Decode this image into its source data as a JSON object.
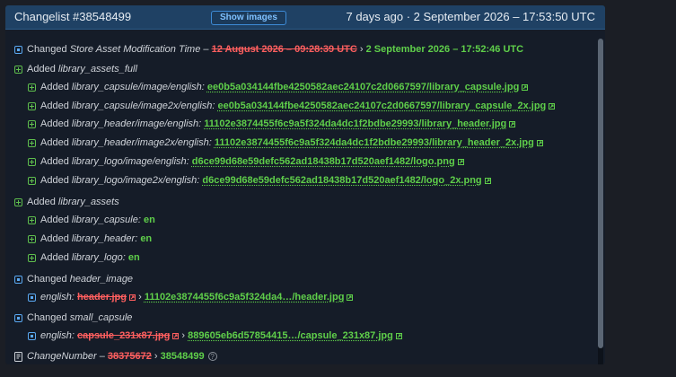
{
  "header": {
    "title": "Changelist #38548499",
    "show_images_label": "Show images",
    "date": "7 days ago · 2 September 2026 – 17:53:50 UTC"
  },
  "rows": {
    "r0": {
      "verb": "Changed",
      "key": "Store Asset Modification Time",
      "dash": "–",
      "old": "12 August 2026 – 09:28:39 UTC",
      "sep": "›",
      "new": "2 September 2026 – 17:52:46 UTC"
    },
    "r1": {
      "verb": "Added",
      "key": "library_assets_full"
    },
    "r2": {
      "verb": "Added",
      "key": "library_capsule/image/english:",
      "value": "ee0b5a034144fbe4250582aec24107c2d0667597/library_capsule.jpg"
    },
    "r3": {
      "verb": "Added",
      "key": "library_capsule/image2x/english:",
      "value": "ee0b5a034144fbe4250582aec24107c2d0667597/library_capsule_2x.jpg"
    },
    "r4": {
      "verb": "Added",
      "key": "library_header/image/english:",
      "value": "11102e3874455f6c9a5f324da4dc1f2bdbe29993/library_header.jpg"
    },
    "r5": {
      "verb": "Added",
      "key": "library_header/image2x/english:",
      "value": "11102e3874455f6c9a5f324da4dc1f2bdbe29993/library_header_2x.jpg"
    },
    "r6": {
      "verb": "Added",
      "key": "library_logo/image/english:",
      "value": "d6ce99d68e59defc562ad18438b17d520aef1482/logo.png"
    },
    "r7": {
      "verb": "Added",
      "key": "library_logo/image2x/english:",
      "value": "d6ce99d68e59defc562ad18438b17d520aef1482/logo_2x.png"
    },
    "r8": {
      "verb": "Added",
      "key": "library_assets"
    },
    "r9": {
      "verb": "Added",
      "key": "library_capsule:",
      "value": "en"
    },
    "r10": {
      "verb": "Added",
      "key": "library_header:",
      "value": "en"
    },
    "r11": {
      "verb": "Added",
      "key": "library_logo:",
      "value": "en"
    },
    "r12": {
      "verb": "Changed",
      "key": "header_image"
    },
    "r13": {
      "key": "english:",
      "old": "header.jpg",
      "sep": "›",
      "new": "11102e3874455f6c9a5f324da4…/header.jpg"
    },
    "r14": {
      "verb": "Changed",
      "key": "small_capsule"
    },
    "r15": {
      "key": "english:",
      "old": "capsule_231x87.jpg",
      "sep": "›",
      "new": "889605eb6d57854415…/capsule_231x87.jpg"
    },
    "r16": {
      "key": "ChangeNumber",
      "dash": "–",
      "old": "38375672",
      "sep": "›",
      "new": "38548499",
      "help": "?"
    }
  },
  "colors": {
    "header_bg": "#1f4164",
    "panel_bg": "#151c28",
    "added": "#5fbf4d",
    "changed": "#5aa9f2",
    "removed": "#ff5f5f"
  },
  "icons": [
    "changed-icon",
    "added-icon",
    "external-link-icon",
    "changelist-icon",
    "help-icon"
  ]
}
